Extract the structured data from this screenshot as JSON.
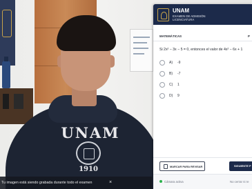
{
  "recording_notice": {
    "text": "Tu imagen está siendo grabada durante todo el examen",
    "close_glyph": "×"
  },
  "webcam_print": {
    "university": "UNAM",
    "year": "1910"
  },
  "header": {
    "title": "UNAM",
    "subtitle_line1": "EXAMEN DE ADMISIÓN",
    "subtitle_line2": "LICENCIATURA"
  },
  "exam": {
    "subject": "MATEMÁTICAS",
    "subject_right": "P",
    "question": "Si 2x² − 3x − 5 = 0, entonces el valor de  4x² − 6x + 1",
    "options": [
      {
        "letter": "A)",
        "value": "-9"
      },
      {
        "letter": "B)",
        "value": "-7"
      },
      {
        "letter": "C)",
        "value": "1"
      },
      {
        "letter": "D)",
        "value": "9"
      }
    ]
  },
  "buttons": {
    "flag_label": "MARCAR PARA REVISAR",
    "next_label": "SIGUIENTE P"
  },
  "status": {
    "camera": "Cámara activa",
    "right": "No cerrar ni re"
  },
  "colors": {
    "header_bg": "#1c2a4a",
    "camera_active": "#2bb24c"
  },
  "icons": [
    "unam-logo-icon",
    "radio-icon",
    "flag-icon",
    "close-icon",
    "status-dot-icon"
  ]
}
